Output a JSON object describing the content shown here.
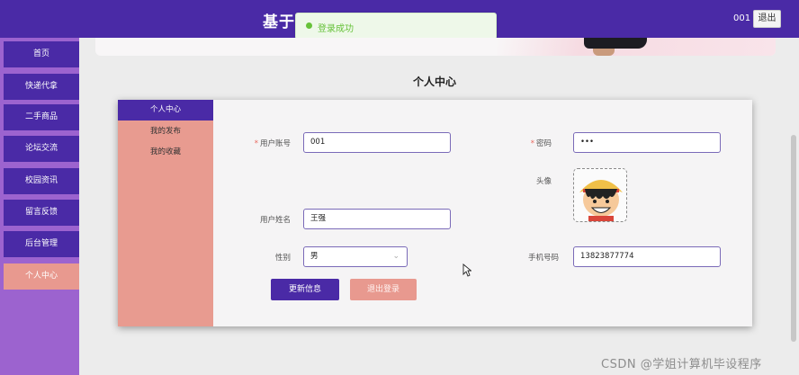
{
  "header": {
    "site_title": "基于",
    "title_tail": "",
    "username": "001",
    "logout_label": "退出",
    "brand_color": "#4a2aa6"
  },
  "toast": {
    "message": "登录成功",
    "icon": "success-dot-icon"
  },
  "sidebar": {
    "items": [
      {
        "label": "首页"
      },
      {
        "label": "快递代拿"
      },
      {
        "label": "二手商品"
      },
      {
        "label": "论坛交流"
      },
      {
        "label": "校园资讯"
      },
      {
        "label": "留言反馈"
      },
      {
        "label": "后台管理"
      },
      {
        "label": "个人中心",
        "active": true
      }
    ]
  },
  "page": {
    "heading": "个人中心"
  },
  "card_menu": {
    "items": [
      {
        "label": "个人中心",
        "active": true
      },
      {
        "label": "我的发布"
      },
      {
        "label": "我的收藏"
      }
    ]
  },
  "form": {
    "account": {
      "label": "用户账号",
      "required": "*",
      "value": "001"
    },
    "password": {
      "label": "密码",
      "required": "*",
      "value": "•••"
    },
    "avatar": {
      "label": "头像"
    },
    "name": {
      "label": "用户姓名",
      "value": "王强"
    },
    "gender": {
      "label": "性别",
      "value": "男"
    },
    "phone": {
      "label": "手机号码",
      "value": "13823877774"
    },
    "update_button": "更新信息",
    "signout_button": "退出登录"
  },
  "watermark": "CSDN @学姐计算机毕设程序",
  "colors": {
    "accent_pink": "#e8998f",
    "sidebar_bg": "#9c63cf",
    "success": "#67c23a"
  }
}
